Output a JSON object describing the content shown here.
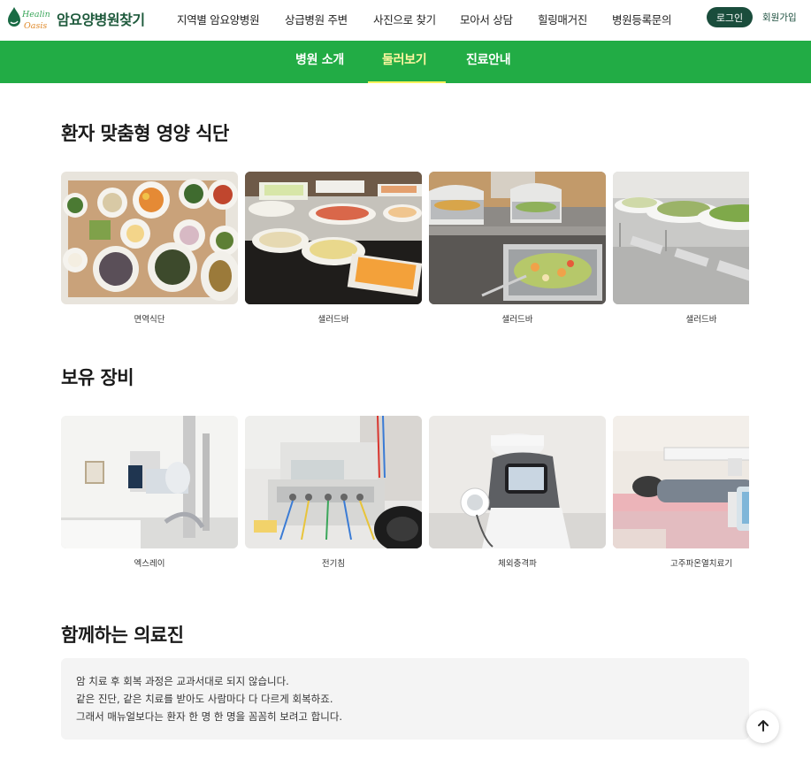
{
  "header": {
    "logo_script_top": "Healing",
    "logo_script_bottom": "Oasis",
    "logo_text": "암요양병원찾기",
    "nav": [
      "지역별 암요양병원",
      "상급병원 주변",
      "사진으로 찾기",
      "모아서 상담",
      "힐링매거진",
      "병원등록문의"
    ],
    "login_label": "로그인",
    "signup_label": "회원가입"
  },
  "sub_nav": {
    "tabs": [
      "병원 소개",
      "둘러보기",
      "진료안내"
    ],
    "active_index": 1,
    "active_color": "#fff35c"
  },
  "diet": {
    "title": "환자 맞춤형 영양 식단",
    "items": [
      {
        "caption": "면역식단",
        "icon": "meal-tray-photo"
      },
      {
        "caption": "샐러드바",
        "icon": "salad-bar-photo"
      },
      {
        "caption": "샐러드바",
        "icon": "buffet-photo"
      },
      {
        "caption": "샐러드바",
        "icon": "salad-bowls-photo"
      }
    ]
  },
  "equipment": {
    "title": "보유 장비",
    "items": [
      {
        "caption": "엑스레이",
        "icon": "xray-machine-photo"
      },
      {
        "caption": "전기침",
        "icon": "electro-acupuncture-photo"
      },
      {
        "caption": "체외충격파",
        "icon": "shockwave-machine-photo"
      },
      {
        "caption": "고주파온열치료기",
        "icon": "hyperthermia-device-photo"
      }
    ]
  },
  "medical_team": {
    "title": "함께하는 의료진",
    "lines": [
      "암 치료 후 회복 과정은 교과서대로 되지 않습니다.",
      "같은 진단, 같은 치료를 받아도 사람마다 다 다르게 회복하죠.",
      "그래서 매뉴얼보다는 환자 한 명 한 명을 꼼꼼히 보려고 합니다."
    ]
  },
  "colors": {
    "brand_green": "#22ac45",
    "dark_green": "#1a4d3c",
    "text_box_bg": "#f4f4f4"
  },
  "icons": {
    "scroll_top": "arrow-up-icon"
  }
}
